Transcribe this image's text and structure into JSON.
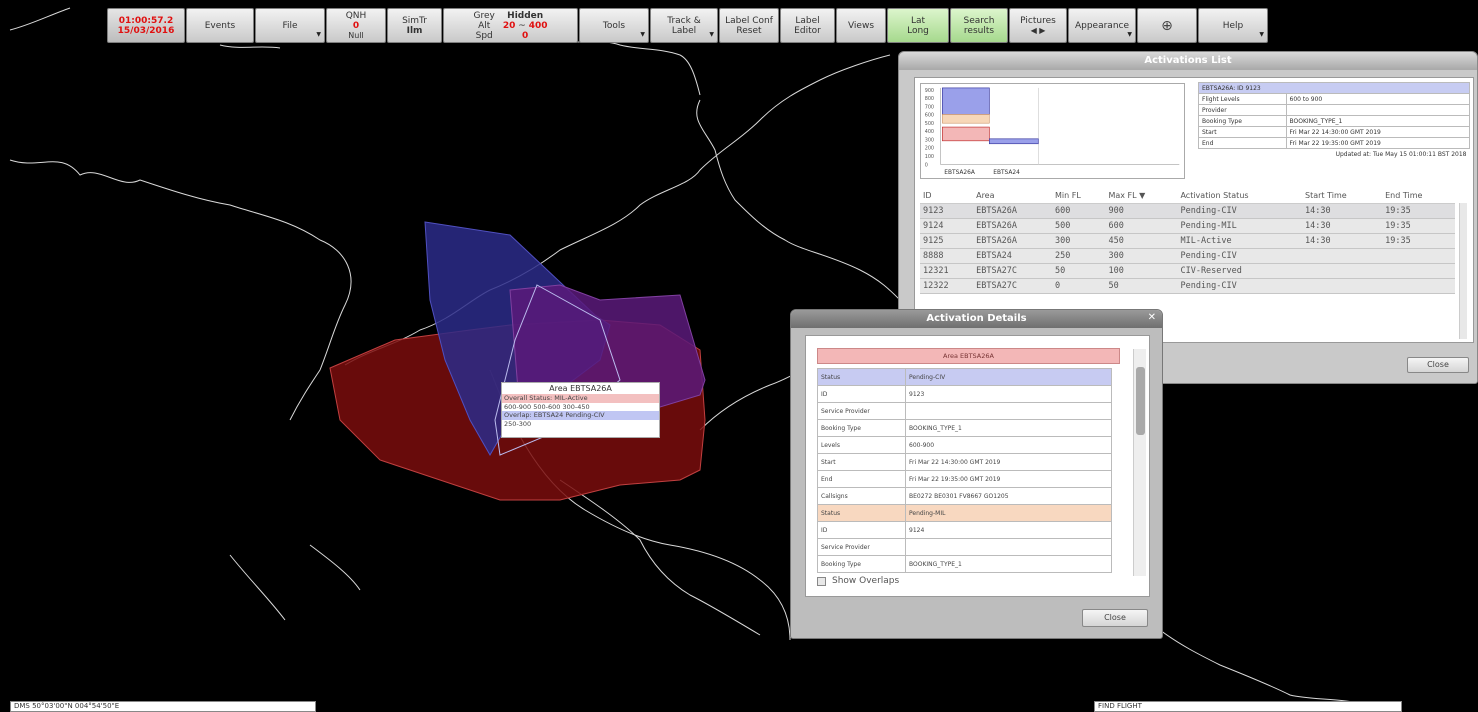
{
  "toolbar": {
    "clock_time": "01:00:57.2",
    "clock_date": "15/03/2016",
    "events": "Events",
    "file": "File",
    "qnh_label": "QNH",
    "qnh_value": "0",
    "qnh_sub": "Null",
    "simtr_label": "SimTr",
    "simtr_value": "Ilm",
    "grey_label": "Grey",
    "grey_alt": "Alt",
    "grey_spd": "Spd",
    "hidden_label": "Hidden",
    "hidden_low": "20",
    "hidden_sep": "~",
    "hidden_high": "400",
    "hidden_sub": "0",
    "tools": "Tools",
    "track_label_1": "Track &",
    "track_label_2": "Label",
    "label_conf_1": "Label Conf",
    "label_conf_2": "Reset",
    "label_editor_1": "Label",
    "label_editor_2": "Editor",
    "views": "Views",
    "latlong_1": "Lat",
    "latlong_2": "Long",
    "search_1": "Search",
    "search_2": "results",
    "pictures": "Pictures",
    "appearance": "Appearance",
    "help": "Help"
  },
  "activations_list": {
    "title": "Activations List",
    "info_header": "EBTSA26A: ID 9123",
    "info_rows": [
      [
        "Flight Levels",
        "600 to 900"
      ],
      [
        "Provider",
        ""
      ],
      [
        "Booking Type",
        "BOOKING_TYPE_1"
      ],
      [
        "Start",
        "Fri Mar 22 14:30:00 GMT 2019"
      ],
      [
        "End",
        "Fri Mar 22 19:35:00 GMT 2019"
      ]
    ],
    "updated": "Updated at: Tue May 15 01:00:11 BST 2018",
    "hist_labels": [
      "EBTSA26A",
      "EBTSA24"
    ],
    "hist_ticks": [
      "900",
      "800",
      "700",
      "600",
      "500",
      "400",
      "300",
      "200",
      "100",
      "0"
    ],
    "columns": [
      "ID",
      "Area",
      "Min FL",
      "Max FL ▼",
      "Activation Status",
      "Start Time",
      "End Time"
    ],
    "rows": [
      [
        "9123",
        "EBTSA26A",
        "600",
        "900",
        "Pending-CIV",
        "14:30",
        "19:35"
      ],
      [
        "9124",
        "EBTSA26A",
        "500",
        "600",
        "Pending-MIL",
        "14:30",
        "19:35"
      ],
      [
        "9125",
        "EBTSA26A",
        "300",
        "450",
        "MIL-Active",
        "14:30",
        "19:35"
      ],
      [
        "8888",
        "EBTSA24",
        "250",
        "300",
        "Pending-CIV",
        "",
        ""
      ],
      [
        "12321",
        "EBTSA27C",
        "50",
        "100",
        "CIV-Reserved",
        "",
        ""
      ],
      [
        "12322",
        "EBTSA27C",
        "0",
        "50",
        "Pending-CIV",
        "",
        ""
      ]
    ],
    "close": "Close"
  },
  "activation_details": {
    "title": "Activation Details",
    "header": "Area EBTSA26A",
    "rows": [
      {
        "k": "Status",
        "v": "Pending-CIV",
        "style": "blue"
      },
      {
        "k": "ID",
        "v": "9123",
        "style": ""
      },
      {
        "k": "Service Provider",
        "v": "",
        "style": ""
      },
      {
        "k": "Booking Type",
        "v": "BOOKING_TYPE_1",
        "style": ""
      },
      {
        "k": "Levels",
        "v": "600-900",
        "style": ""
      },
      {
        "k": "Start",
        "v": "Fri Mar 22 14:30:00 GMT 2019",
        "style": ""
      },
      {
        "k": "End",
        "v": "Fri Mar 22 19:35:00 GMT 2019",
        "style": ""
      },
      {
        "k": "Callsigns",
        "v": "BE0272 BE0301 FV8667 GO1205",
        "style": ""
      },
      {
        "k": "Status",
        "v": "Pending-MIL",
        "style": "orange"
      },
      {
        "k": "ID",
        "v": "9124",
        "style": ""
      },
      {
        "k": "Service Provider",
        "v": "",
        "style": ""
      },
      {
        "k": "Booking Type",
        "v": "BOOKING_TYPE_1",
        "style": ""
      }
    ],
    "show_overlaps": "Show Overlaps",
    "close": "Close"
  },
  "map_tooltip": {
    "title": "Area EBTSA26A",
    "overall": "Overall Status: MIL-Active",
    "levels": "600-900   500-600   300-450",
    "overlap": "Overlap: EBTSA24 Pending-CIV",
    "overlap_levels": "250-300"
  },
  "status_bar": {
    "left": "DMS  50°03'00\"N 004°54'50\"E",
    "right": "FIND FLIGHT"
  },
  "colors": {
    "alert_red": "#e01010",
    "area_red": "#7a0d0d",
    "area_blue": "#2b2b8a",
    "area_purple": "#5a1a7a",
    "latlong_green": "#a6d98d"
  }
}
